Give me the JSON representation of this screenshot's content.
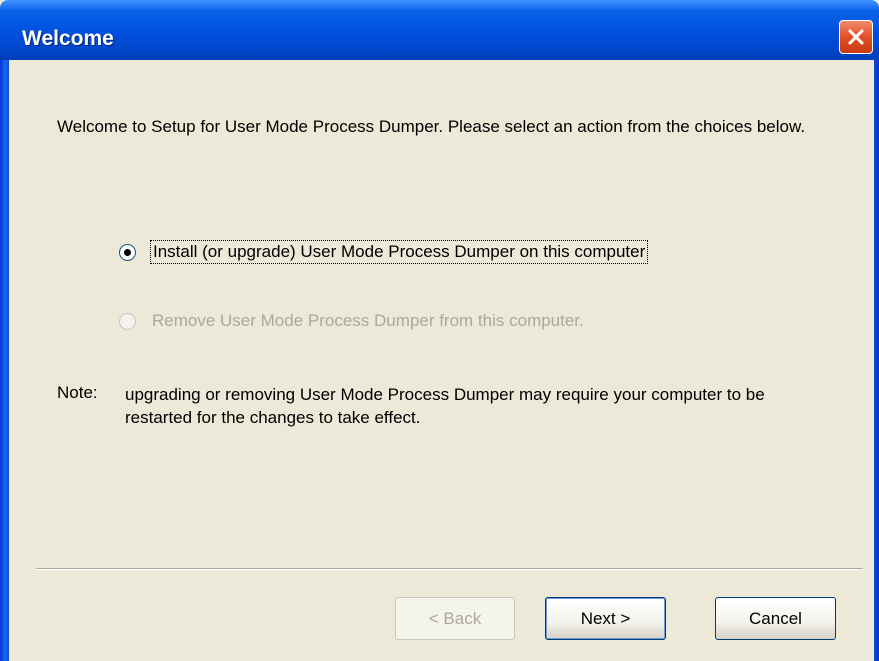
{
  "window": {
    "title": "Welcome"
  },
  "intro": {
    "text": "Welcome to Setup for User Mode Process Dumper. Please select an action from the choices below."
  },
  "options": [
    {
      "label": "Install (or upgrade) User Mode Process Dumper on this computer",
      "selected": true,
      "enabled": true,
      "access_key": "I"
    },
    {
      "label": "Remove User Mode Process Dumper from this computer.",
      "selected": false,
      "enabled": false,
      "access_key": "R"
    }
  ],
  "note": {
    "label": "Note:",
    "text": "upgrading or removing User Mode Process Dumper may require your computer to be restarted for the changes to take effect."
  },
  "buttons": {
    "back": {
      "label": "< Back",
      "enabled": false
    },
    "next": {
      "label": "Next >",
      "enabled": true
    },
    "cancel": {
      "label": "Cancel",
      "enabled": true
    }
  },
  "icons": {
    "close": "close-icon"
  }
}
